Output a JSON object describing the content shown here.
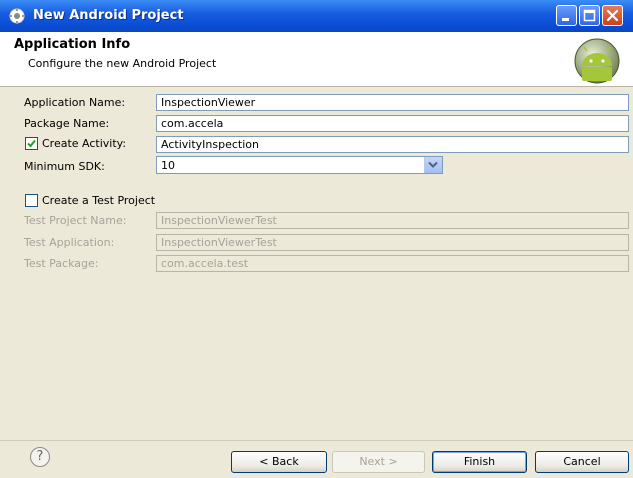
{
  "window": {
    "title": "New Android Project",
    "icon": "eclipse-gear-icon",
    "controls": [
      "minimize-icon",
      "maximize-icon",
      "close-icon"
    ]
  },
  "banner": {
    "title": "Application Info",
    "subtitle": "Configure the new Android Project",
    "logo": "android-logo"
  },
  "form": {
    "application_name": {
      "label": "Application Name:",
      "value": "InspectionViewer"
    },
    "package_name": {
      "label": "Package Name:",
      "value": "com.accela"
    },
    "create_activity": {
      "label": "Create Activity:",
      "checked": true,
      "value": "ActivityInspection"
    },
    "minimum_sdk": {
      "label": "Minimum SDK:",
      "value": "10"
    }
  },
  "test_project": {
    "checkbox_label": "Create a Test Project",
    "checked": false,
    "project_name": {
      "label": "Test Project Name:",
      "value": "InspectionViewerTest"
    },
    "application": {
      "label": "Test Application:",
      "value": "InspectionViewerTest"
    },
    "package": {
      "label": "Test Package:",
      "value": "com.accela.test"
    }
  },
  "buttons": {
    "help": "?",
    "back": "< Back",
    "next": "Next >",
    "finish": "Finish",
    "cancel": "Cancel"
  },
  "colors": {
    "titlebar": "#0a4fd6",
    "dialog_bg": "#ece9d8",
    "field_border": "#7f9db9",
    "disabled_text": "#a6a39a",
    "android_green": "#a4c639"
  }
}
